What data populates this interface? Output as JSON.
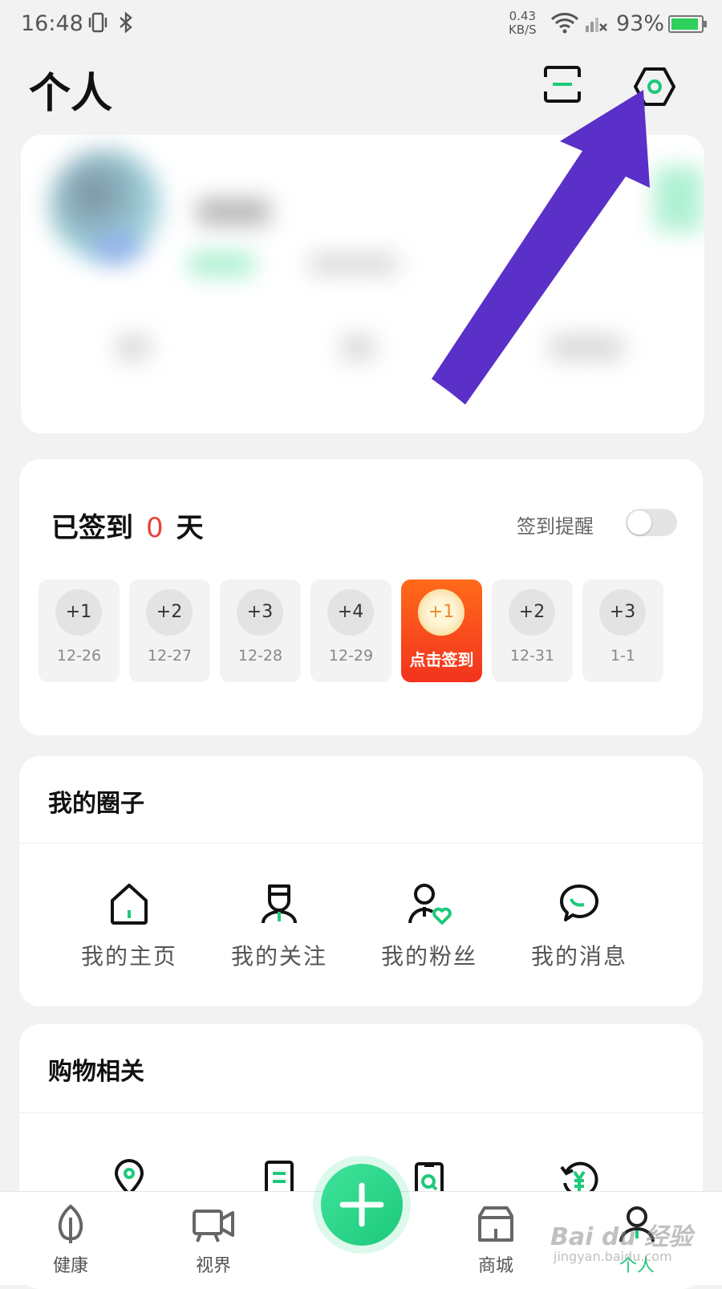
{
  "status_bar": {
    "time": "16:48",
    "net_speed_value": "0.43",
    "net_speed_unit": "KB/S",
    "battery": "93%",
    "battery_level": 0.93,
    "battery_color": "#2ecf5a"
  },
  "header": {
    "title": "个人",
    "scan_icon": "scan-icon",
    "settings_icon": "hexagon-settings-icon"
  },
  "checkin": {
    "label_prefix": "已签到",
    "count": "0",
    "label_suffix": "天",
    "reminder_label": "签到提醒",
    "reminder_on": false,
    "days": [
      {
        "reward": "+1",
        "date": "12-26"
      },
      {
        "reward": "+2",
        "date": "12-27"
      },
      {
        "reward": "+3",
        "date": "12-28"
      },
      {
        "reward": "+4",
        "date": "12-29"
      },
      {
        "reward": "+1",
        "date": "点击签到"
      },
      {
        "reward": "+2",
        "date": "12-31"
      },
      {
        "reward": "+3",
        "date": "1-1"
      }
    ]
  },
  "circle": {
    "title": "我的圈子",
    "items": [
      {
        "label": "我的主页",
        "icon": "home-icon"
      },
      {
        "label": "我的关注",
        "icon": "person-icon"
      },
      {
        "label": "我的粉丝",
        "icon": "fans-heart-icon"
      },
      {
        "label": "我的消息",
        "icon": "chat-bubble-icon"
      }
    ]
  },
  "shopping": {
    "title": "购物相关",
    "items": [
      {
        "icon": "location-pin-icon"
      },
      {
        "icon": "order-list-icon"
      },
      {
        "icon": "clipboard-search-icon"
      },
      {
        "icon": "refund-yen-icon"
      }
    ]
  },
  "nav": {
    "items": [
      {
        "label": "健康",
        "icon": "leaf-icon"
      },
      {
        "label": "视界",
        "icon": "video-camera-icon"
      },
      {
        "label": "",
        "icon": "plus-icon"
      },
      {
        "label": "商城",
        "icon": "store-icon"
      },
      {
        "label": "个人",
        "icon": "user-icon"
      }
    ]
  },
  "colors": {
    "accent_green": "#1ec97b",
    "checkin_active": "#f3331f",
    "count_red": "#e8443a",
    "annotation_arrow": "#5a30c8"
  },
  "watermark": {
    "brand": "Bai du 经验",
    "url": "jingyan.baidu.com"
  }
}
